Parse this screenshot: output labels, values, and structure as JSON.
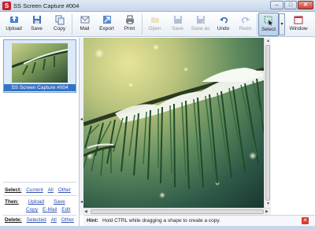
{
  "window": {
    "app_icon": "S",
    "title": "SS Screen Capture #004",
    "controls": {
      "minimize": "–",
      "maximize": "□",
      "close": "✕"
    }
  },
  "toolbar": {
    "upload": "Upload",
    "save": "Save",
    "copy": "Copy",
    "mail": "Mail",
    "export": "Export",
    "print": "Print",
    "open": "Open",
    "save2": "Save",
    "save_as": "Save as",
    "undo": "Undo",
    "redo": "Redo",
    "select": "Select",
    "select_dropdown": "▾",
    "window": "Window"
  },
  "thumbnail": {
    "caption": "SS Screen Capture #004"
  },
  "commands": {
    "select": {
      "label": "Select:",
      "current": "Current",
      "all": "All",
      "other": "Other"
    },
    "then": {
      "label": "Then:",
      "upload": "Upload",
      "save": "Save",
      "copy": "Copy",
      "email": "E-Mail",
      "edit": "Edit"
    },
    "delete": {
      "label": "Delete:",
      "selected": "Selected",
      "all": "All",
      "other": "Other"
    }
  },
  "splitter": {
    "arrow_up": "◂",
    "arrow_down": "◂"
  },
  "hint": {
    "label": "Hint:",
    "text": "Hold CTRL while dragging a shape to create a copy.",
    "close": "✕"
  },
  "scrollbars": {
    "up": "▲",
    "down": "▼",
    "left": "◀",
    "right": "▶"
  },
  "colors": {
    "accent": "#3672c4",
    "link": "#2a4fb3",
    "close": "#d93c2f"
  }
}
